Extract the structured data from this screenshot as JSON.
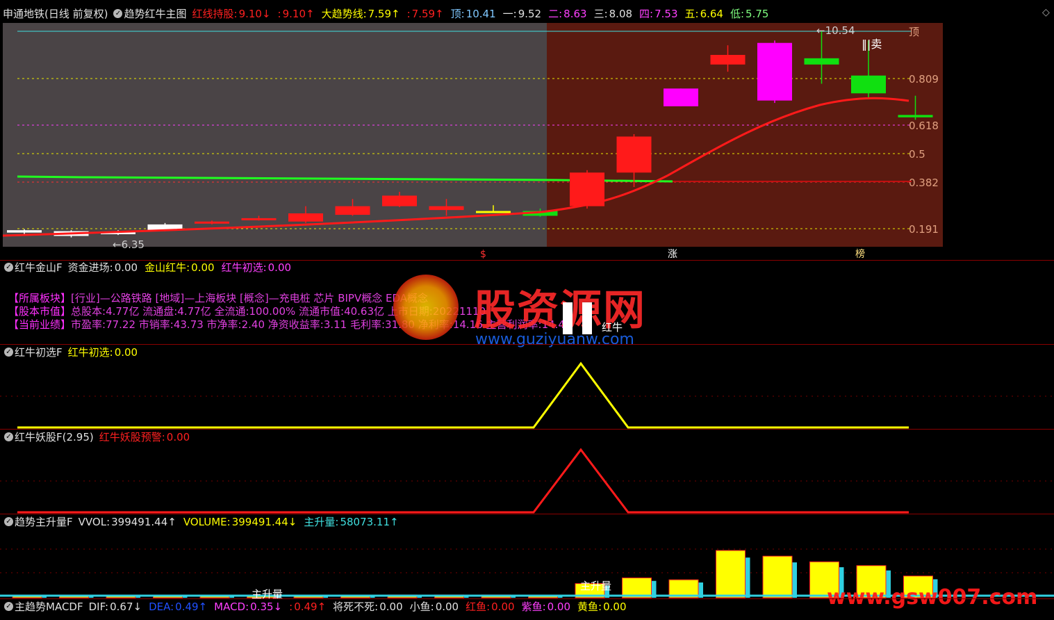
{
  "main_header": {
    "stock": "申通地铁(日线 前复权)",
    "indicator": "趋势红牛主图",
    "items": [
      {
        "label": "红线持股:",
        "value": "9.10",
        "arrow": "↓",
        "color": "#ff2020"
      },
      {
        "label": ":",
        "value": "9.10",
        "arrow": "↑",
        "color": "#ff2020"
      },
      {
        "label": "大趋势线:",
        "value": "7.59",
        "arrow": "↑",
        "color": "#ffff00"
      },
      {
        "label": ":",
        "value": "7.59",
        "arrow": "↑",
        "color": "#ff2020"
      },
      {
        "label": "顶:",
        "value": "10.41",
        "arrow": "",
        "color": "#80c8ff"
      },
      {
        "label": "一:",
        "value": "9.52",
        "arrow": "",
        "color": "#e0e0e0"
      },
      {
        "label": "二:",
        "value": "8.63",
        "arrow": "",
        "color": "#ff40ff"
      },
      {
        "label": "三:",
        "value": "8.08",
        "arrow": "",
        "color": "#e0e0e0"
      },
      {
        "label": "四:",
        "value": "7.53",
        "arrow": "",
        "color": "#ff40ff"
      },
      {
        "label": "五:",
        "value": "6.64",
        "arrow": "",
        "color": "#ffff00"
      },
      {
        "label": "低:",
        "value": "5.75",
        "arrow": "",
        "color": "#80ff80"
      }
    ]
  },
  "main_chart": {
    "fib_labels": [
      "顶",
      "0.809",
      "0.618",
      "0.5",
      "0.382",
      "0.191"
    ],
    "high_label": "10.54",
    "low_label": "6.35",
    "sell_label": "卖",
    "markers": [
      "$",
      "涨",
      "榜"
    ],
    "candles": [
      {
        "o": 6.4,
        "c": 6.35,
        "h": 6.42,
        "l": 6.3,
        "type": "white"
      },
      {
        "o": 6.38,
        "c": 6.28,
        "h": 6.4,
        "l": 6.25,
        "type": "white"
      },
      {
        "o": 6.36,
        "c": 6.32,
        "h": 6.4,
        "l": 6.3,
        "type": "white"
      },
      {
        "o": 6.4,
        "c": 6.52,
        "h": 6.55,
        "l": 6.38,
        "type": "white"
      },
      {
        "o": 6.55,
        "c": 6.58,
        "h": 6.6,
        "l": 6.52,
        "type": "red"
      },
      {
        "o": 6.62,
        "c": 6.65,
        "h": 6.7,
        "l": 6.6,
        "type": "red"
      },
      {
        "o": 6.58,
        "c": 6.75,
        "h": 6.9,
        "l": 6.55,
        "type": "red"
      },
      {
        "o": 6.72,
        "c": 6.9,
        "h": 7.05,
        "l": 6.7,
        "type": "red"
      },
      {
        "o": 6.9,
        "c": 7.12,
        "h": 7.2,
        "l": 6.88,
        "type": "red"
      },
      {
        "o": 6.9,
        "c": 6.82,
        "h": 7.05,
        "l": 6.7,
        "type": "red"
      },
      {
        "o": 6.78,
        "c": 6.8,
        "h": 6.92,
        "l": 6.76,
        "type": "yellow"
      },
      {
        "o": 6.8,
        "c": 6.7,
        "h": 6.85,
        "l": 6.68,
        "type": "green"
      },
      {
        "o": 7.6,
        "c": 6.9,
        "h": 7.65,
        "l": 6.85,
        "type": "red"
      },
      {
        "o": 7.6,
        "c": 8.35,
        "h": 8.4,
        "l": 7.3,
        "type": "red"
      },
      {
        "o": 8.98,
        "c": 9.35,
        "h": 9.35,
        "l": 8.98,
        "type": "magenta"
      },
      {
        "o": 9.85,
        "c": 10.05,
        "h": 10.25,
        "l": 9.7,
        "type": "red"
      },
      {
        "o": 9.1,
        "c": 10.3,
        "h": 10.35,
        "l": 9.05,
        "type": "magenta"
      },
      {
        "o": 9.98,
        "c": 9.85,
        "h": 10.54,
        "l": 9.45,
        "type": "green"
      },
      {
        "o": 9.62,
        "c": 9.25,
        "h": 10.35,
        "l": 9.15,
        "type": "green"
      },
      {
        "o": 8.75,
        "c": 8.8,
        "h": 9.2,
        "l": 8.7,
        "type": "green"
      }
    ]
  },
  "panel1": {
    "title": "红牛金山F",
    "items": [
      {
        "label": "资金进场:",
        "value": "0.00",
        "color": "#e0e0e0"
      },
      {
        "label": "金山红牛:",
        "value": "0.00",
        "color": "#ffff00"
      },
      {
        "label": "红牛初选:",
        "value": "0.00",
        "color": "#ff40ff"
      }
    ],
    "info_lines": [
      {
        "tag": "【所属板块】",
        "text": "[行业]—公路铁路 [地域]—上海板块 [概念]—充电桩 芯片 BIPV概念 EDA概念"
      },
      {
        "tag": "【股本市值】",
        "text": "总股本:4.77亿 流通盘:4.77亿 全流通:100.00% 流通市值:40.63亿 上市日期:20221110"
      },
      {
        "tag": "【当前业绩】",
        "text": "市盈率:77.22 市销率:43.73 市净率:2.40 净资收益率:3.11 毛利率:31.80 净利率:14.16 主营利润率:14.43"
      }
    ],
    "signal_label": "红牛"
  },
  "panel2": {
    "title": "红牛初选F",
    "items": [
      {
        "label": "红牛初选:",
        "value": "0.00",
        "color": "#ffff00"
      }
    ]
  },
  "panel3": {
    "title": "红牛妖股F(2.95)",
    "items": [
      {
        "label": "红牛妖股预警:",
        "value": "0.00",
        "color": "#ff2020"
      }
    ]
  },
  "panel4": {
    "title": "趋势主升量F",
    "items": [
      {
        "label": "VVOL:",
        "value": "399491.44",
        "arrow": "↑",
        "color": "#e0e0e0"
      },
      {
        "label": "VOLUME:",
        "value": "399491.44",
        "arrow": "↓",
        "color": "#ffff00"
      },
      {
        "label": "主升量:",
        "value": "58073.11",
        "arrow": "↑",
        "color": "#40e0e0"
      }
    ],
    "bar_label_1": "主升量",
    "bar_label_2": "主升量",
    "volumes": [
      0,
      0,
      0,
      0,
      0,
      4,
      4,
      4,
      6,
      6,
      6,
      0,
      30,
      42,
      38,
      100,
      88,
      76,
      68,
      46
    ]
  },
  "panel5": {
    "title": "主趋势MACDF",
    "items": [
      {
        "label": "DIF:",
        "value": "0.67",
        "arrow": "↓",
        "color": "#e0e0e0"
      },
      {
        "label": "DEA:",
        "value": "0.49",
        "arrow": "↑",
        "color": "#2050ff"
      },
      {
        "label": "MACD:",
        "value": "0.35",
        "arrow": "↓",
        "color": "#ff40ff"
      },
      {
        "label": ":",
        "value": "0.49",
        "arrow": "↑",
        "color": "#ff2020"
      },
      {
        "label": "将死不死:",
        "value": "0.00",
        "arrow": "",
        "color": "#e0e0e0"
      },
      {
        "label": "小鱼:",
        "value": "0.00",
        "arrow": "",
        "color": "#e0e0e0"
      },
      {
        "label": "红鱼:",
        "value": "0.00",
        "arrow": "",
        "color": "#ff2020"
      },
      {
        "label": "紫鱼:",
        "value": "0.00",
        "arrow": "",
        "color": "#ff40ff"
      },
      {
        "label": "黄鱼:",
        "value": "0.00",
        "arrow": "",
        "color": "#ffff00"
      }
    ]
  },
  "watermark": {
    "brand": "股资源网",
    "url": "www.guziyuanw.com",
    "corner": "www.gsw007.com"
  },
  "colors": {
    "up": "#ff1a1a",
    "down": "#00ee00",
    "magenta": "#ff00ff",
    "white": "#ffffff",
    "yellow": "#ffff00",
    "bg_left": "#4a4446",
    "bg_right": "#5a1a10"
  }
}
